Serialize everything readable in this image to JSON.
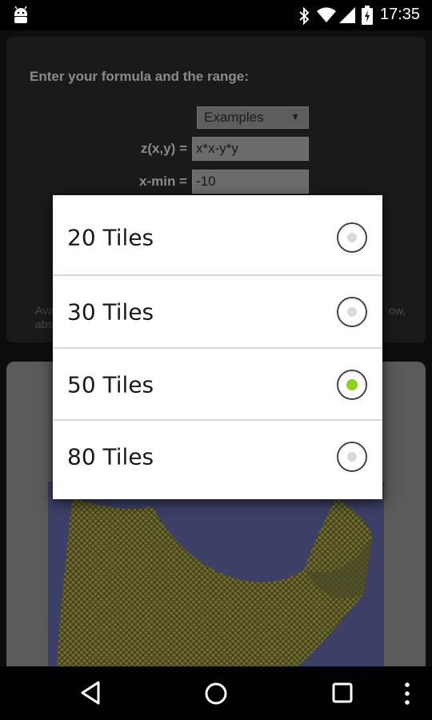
{
  "status_bar": {
    "time": "17:35",
    "icons": [
      "android-icon",
      "bluetooth-icon",
      "wifi-icon",
      "signal-icon",
      "battery-icon"
    ]
  },
  "form": {
    "title": "Enter your formula and the range:",
    "examples_select": {
      "value": "Examples"
    },
    "fields": [
      {
        "label": "z(x,y) =",
        "value": "x*x-y*y"
      },
      {
        "label": "x-min =",
        "value": "-10"
      }
    ],
    "hint_left_line1": "Ava",
    "hint_left_line2": "abs",
    "hint_right": "ow,"
  },
  "dialog": {
    "options": [
      {
        "label": "20 Tiles",
        "selected": false
      },
      {
        "label": "30 Tiles",
        "selected": false
      },
      {
        "label": "50 Tiles",
        "selected": true
      },
      {
        "label": "80 Tiles",
        "selected": false
      }
    ],
    "selected_color": "#8bd31e"
  },
  "nav_bar": {
    "icons": [
      "back-icon",
      "home-icon",
      "recents-icon",
      "overflow-menu-icon"
    ]
  }
}
